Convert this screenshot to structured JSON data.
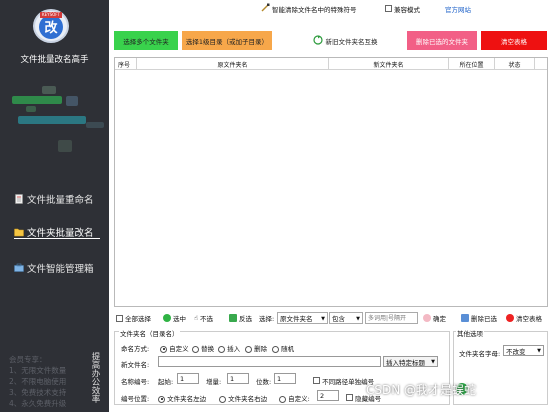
{
  "sidebar": {
    "logo_text": "改",
    "logo_tag": "KEYSOFT",
    "app_title": "文件批量改名高手",
    "items": [
      {
        "label": "文件批量重命名",
        "icon": "file-icon"
      },
      {
        "label": "文件夹批量改名",
        "icon": "folder-icon"
      },
      {
        "label": "文件智能管理箱",
        "icon": "toolbox-icon"
      }
    ],
    "member_lines": [
      "会员专享：",
      "1、无限文件数量",
      "2、不限电脑使用",
      "3、免费技术支持",
      "4、永久免费升级"
    ],
    "slogan": "提高办公效率"
  },
  "topbar": {
    "clean_special": "智能清除文件名中的特殊符号",
    "compat_mode": "兼容模式",
    "website": "官方网站"
  },
  "toolbar": {
    "select_folders": "选择多个文件夹",
    "select_subdirs": "选择1级目录（或加子目录）",
    "swap_names": "新旧文件夹名互换",
    "delete_selected": "删除已选的文件夹",
    "clear_table": "清空表格",
    "colors": {
      "green": "#39d24c",
      "orange": "#f7a74a",
      "pink": "#f25f86",
      "red": "#ee1111"
    }
  },
  "table": {
    "columns": [
      "序号",
      "原文件夹名",
      "新文件夹名",
      "所在位置",
      "状态"
    ]
  },
  "selection": {
    "select_all": "全部选择",
    "select": "选中",
    "unselect": "不选",
    "invert": "反选",
    "choose_label": "选择:",
    "field_value": "原文件夹名",
    "cond_value": "包含",
    "keyword_placeholder": "多词用|号隔开",
    "confirm": "确定",
    "delete_selected": "删除已选",
    "clear_table": "清空表格"
  },
  "group": {
    "title": "文件夹名（目录名）",
    "naming_label": "命名方式:",
    "modes": [
      "自定义",
      "替换",
      "插入",
      "删除",
      "随机"
    ],
    "new_name_label": "新文件名:",
    "insert_label": "插入特定标题",
    "number_label": "名称编号:",
    "start_label": "起始:",
    "start_value": "1",
    "inc_label": "增量:",
    "inc_value": "1",
    "digits_label": "位数:",
    "digits_value": "1",
    "nodup_label": "不同路径单独编号",
    "pos_label": "编号位置:",
    "pos_options": [
      "文件夹名左边",
      "文件夹名右边",
      "自定义:"
    ],
    "custom_value": "2",
    "hide_label": "隐藏编号"
  },
  "other": {
    "title": "其他选项",
    "case_label": "文件夹名字母:",
    "case_value": "不改变"
  },
  "watermark": "CSDN @我才是蜈蛇"
}
